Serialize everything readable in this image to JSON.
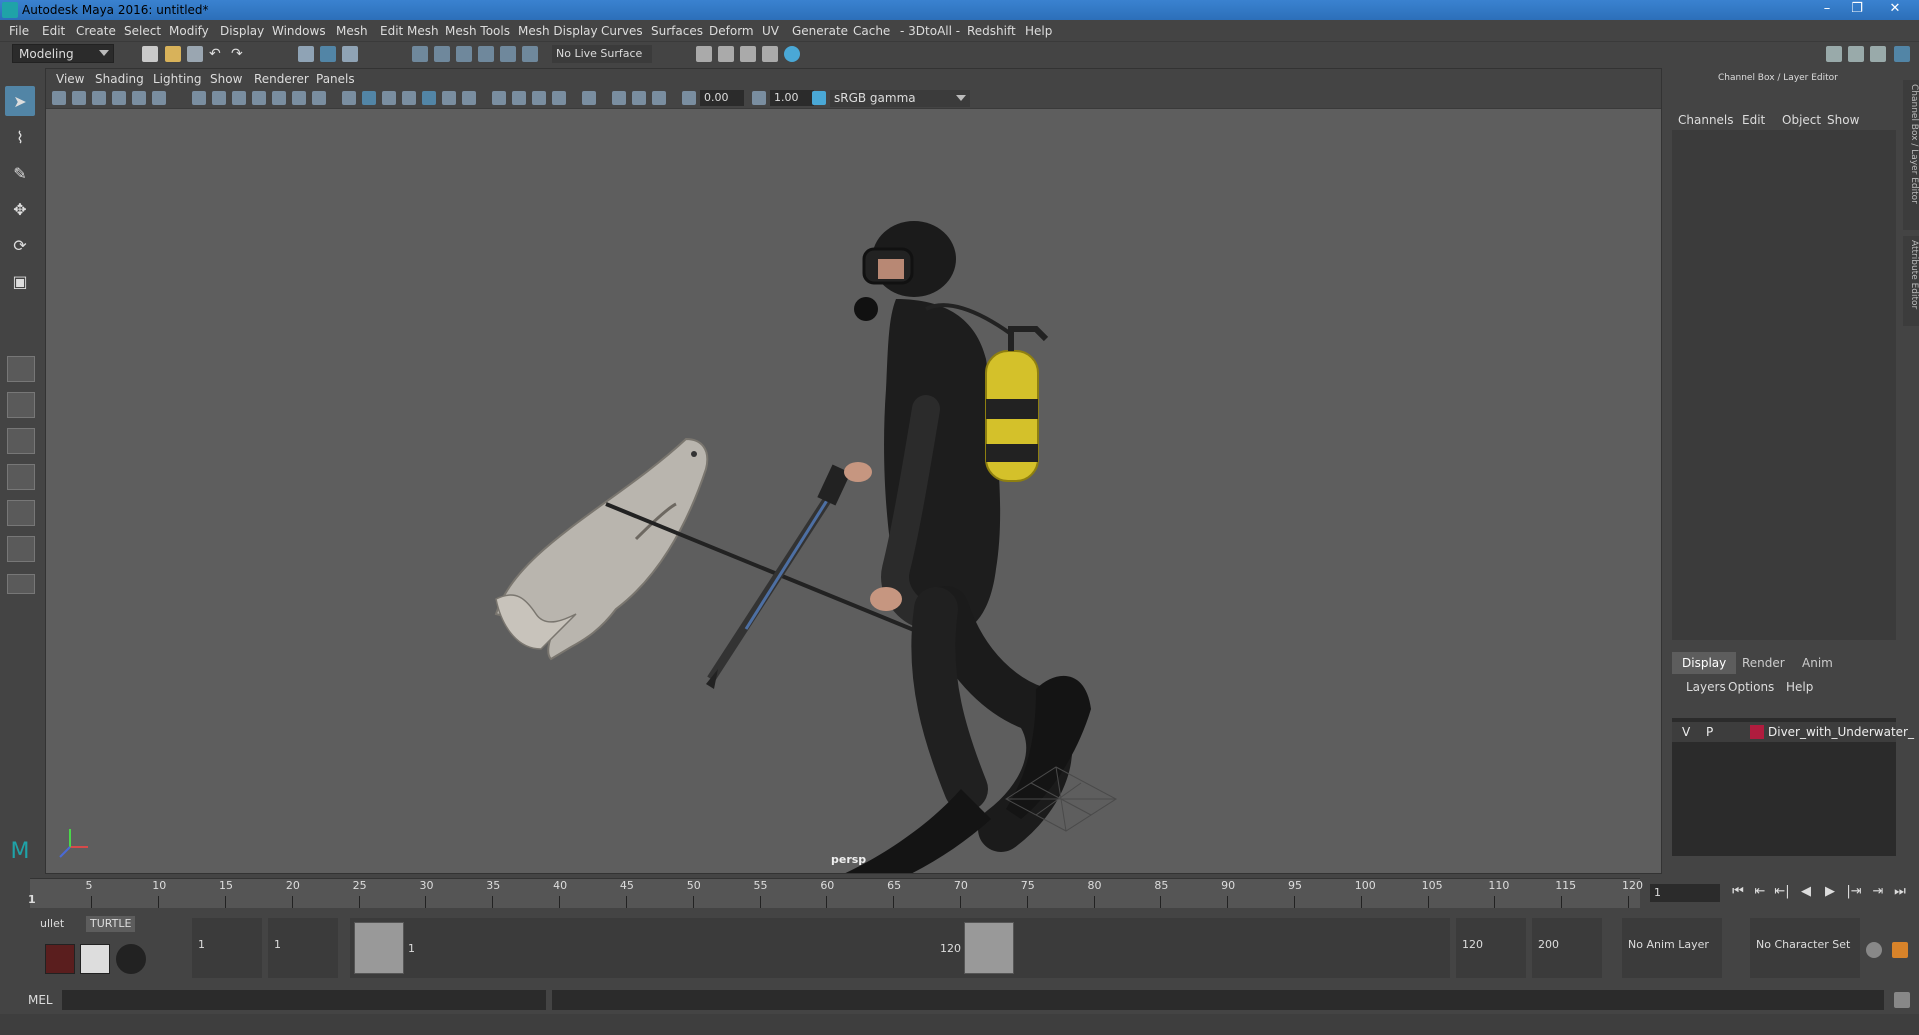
{
  "window": {
    "title": "Autodesk Maya 2016: untitled*",
    "controls": [
      "–",
      "❐",
      "✕"
    ]
  },
  "menubar": {
    "items": [
      "File",
      "Edit",
      "Create",
      "Select",
      "Modify",
      "Display",
      "Windows",
      "Mesh",
      "Edit Mesh",
      "Mesh Tools",
      "Mesh Display",
      "Curves",
      "Surfaces",
      "Deform",
      "UV",
      "Generate",
      "Cache",
      "- 3DtoAll -",
      "Redshift",
      "Help"
    ]
  },
  "statusline": {
    "mode": "Modeling",
    "live_surface": "No Live Surface"
  },
  "panel": {
    "menus": [
      "View",
      "Shading",
      "Lighting",
      "Show",
      "Renderer",
      "Panels"
    ],
    "near_value": "0.00",
    "far_value": "1.00",
    "color_space": "sRGB gamma",
    "camera": "persp"
  },
  "channel_box": {
    "title": "Channel Box / Layer Editor",
    "menus": [
      "Channels",
      "Edit",
      "Object",
      "Show"
    ],
    "tabs": [
      "Display",
      "Render",
      "Anim"
    ],
    "active_tab": "Display",
    "layer_menus": [
      "Layers",
      "Options",
      "Help"
    ],
    "layers": [
      {
        "visible": "V",
        "playback": "P",
        "name": "Diver_with_Underwater_",
        "color": "#b01c3e"
      }
    ],
    "side_tabs": [
      "Channel Box / Layer Editor",
      "Attribute Editor"
    ]
  },
  "timeslider": {
    "ticks": [
      5,
      10,
      15,
      20,
      25,
      30,
      35,
      40,
      45,
      50,
      55,
      60,
      65,
      70,
      75,
      80,
      85,
      90,
      95,
      100,
      105,
      110,
      115,
      120
    ],
    "current_frame_label": "1",
    "current_frame": "1",
    "playback_buttons": [
      "⏮",
      "⇤",
      "⇤|",
      "◀",
      "▶",
      "|⇥",
      "⇥",
      "⏭"
    ]
  },
  "range": {
    "shelf_tabs": [
      "ullet",
      "TURTLE"
    ],
    "start_time": "1",
    "playback_start": "1",
    "range_start": "1",
    "range_end": "120",
    "playback_end": "120",
    "end_time": "200",
    "anim_layer": "No Anim Layer",
    "character_set": "No Character Set"
  },
  "cmdline": {
    "label": "MEL"
  }
}
